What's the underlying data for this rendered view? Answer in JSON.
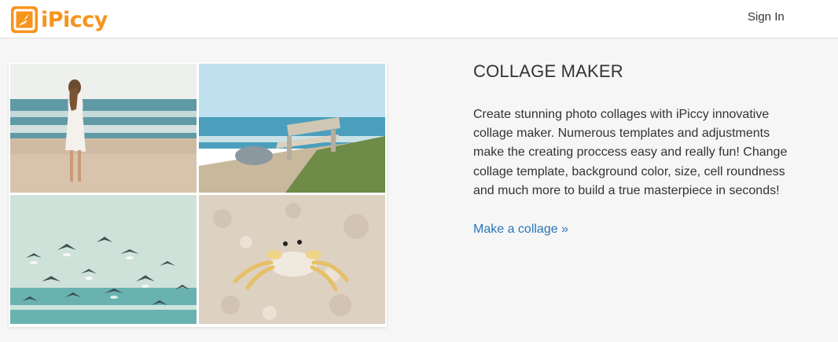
{
  "header": {
    "logo_text": "iPiccy",
    "logo_icon": "ipiccy-logo-icon",
    "signin_label": "Sign In"
  },
  "collage": {
    "photos": [
      "woman-on-beach-photo",
      "beach-bench-photo",
      "seagulls-photo",
      "crab-on-sand-photo"
    ]
  },
  "main": {
    "title": "COLLAGE MAKER",
    "description": "Create stunning photo collages with iPiccy innovative collage maker. Numerous templates and adjustments make the creating proccess easy and really fun! Change collage template, background color, size, cell roundness and much more to build a true masterpiece in seconds!",
    "cta_label": "Make a collage »"
  },
  "colors": {
    "brand": "#f7941d",
    "link": "#2a76b8",
    "background": "#f6f6f6"
  }
}
